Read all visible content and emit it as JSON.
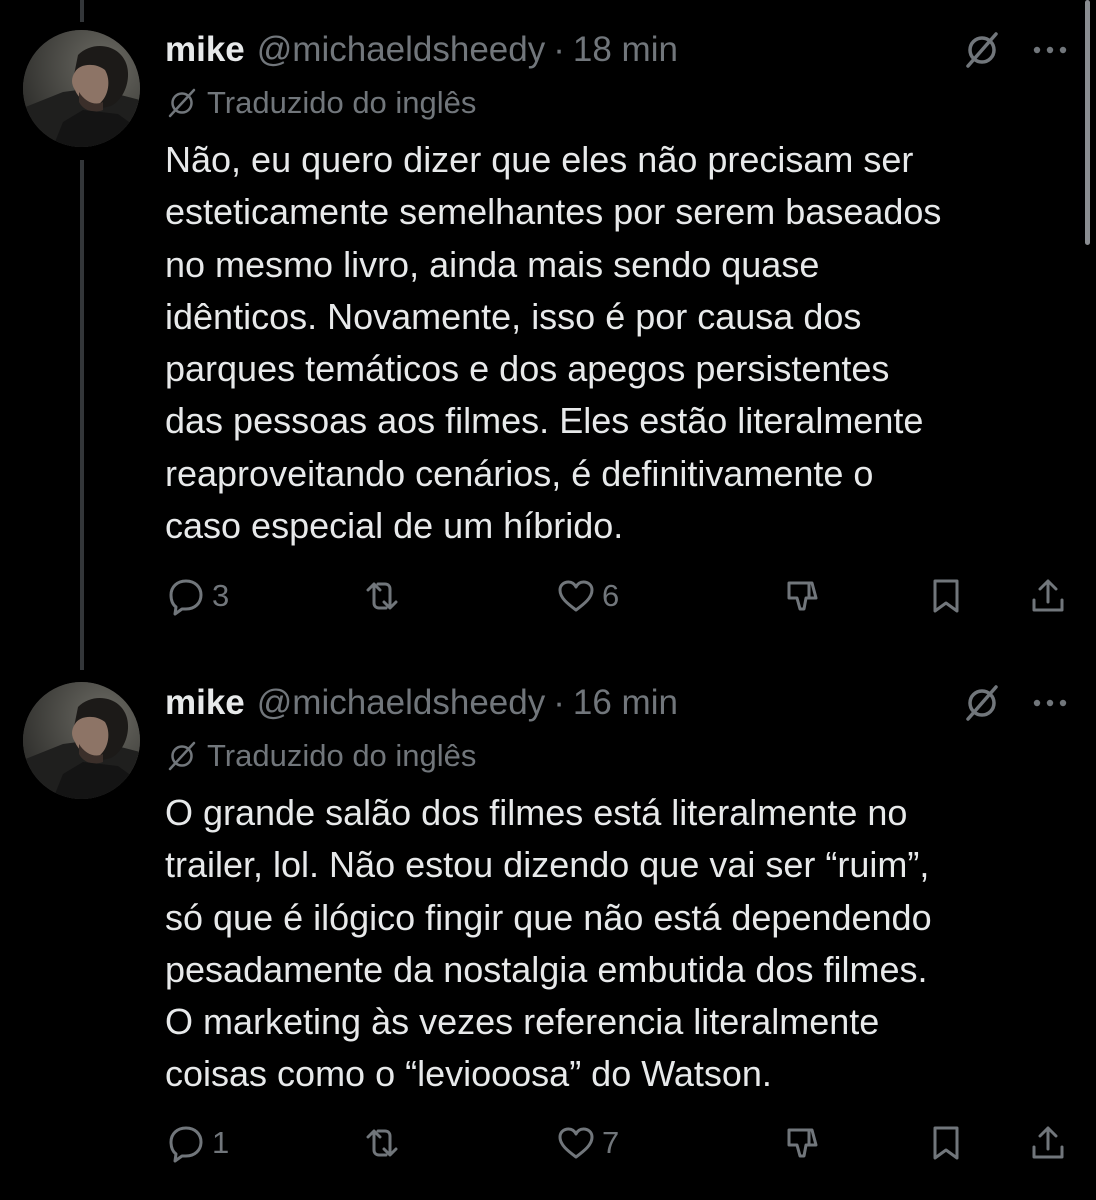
{
  "tweets": [
    {
      "name": "mike",
      "handle": "@michaeldsheedy",
      "separator": "·",
      "time": "18 min",
      "translated_label": "Traduzido do inglês",
      "lines": [
        "Não, eu quero dizer que eles não precisam ser",
        "esteticamente semelhantes por serem baseados",
        "no mesmo livro, ainda mais sendo quase",
        "idênticos. Novamente, isso é por causa dos",
        "parques temáticos e dos apegos persistentes",
        "das pessoas aos filmes. Eles estão literalmente",
        "reaproveitando cenários, é definitivamente o",
        "caso especial de um híbrido."
      ],
      "replies": "3",
      "likes": "6"
    },
    {
      "name": "mike",
      "handle": "@michaeldsheedy",
      "separator": "·",
      "time": "16 min",
      "translated_label": "Traduzido do inglês",
      "lines": [
        "O grande salão dos filmes está literalmente no",
        "trailer, lol. Não estou dizendo que vai ser “ruim”,",
        "só que é ilógico fingir que não está dependendo",
        "pesadamente da nostalgia embutida dos filmes.",
        "O marketing às vezes referencia literalmente",
        "coisas como o “leviooosa” do Watson."
      ],
      "replies": "1",
      "likes": "7"
    }
  ],
  "icons": {
    "grok": "grok-icon",
    "more": "more-icon",
    "translate": "translate-icon",
    "reply": "reply-icon",
    "repost": "repost-icon",
    "like": "heart-icon",
    "downvote": "downvote-icon",
    "bookmark": "bookmark-icon",
    "share": "share-icon"
  },
  "colors": {
    "background": "#000000",
    "text": "#e7e9ea",
    "secondary": "#71767b",
    "thread_line": "#333639"
  }
}
